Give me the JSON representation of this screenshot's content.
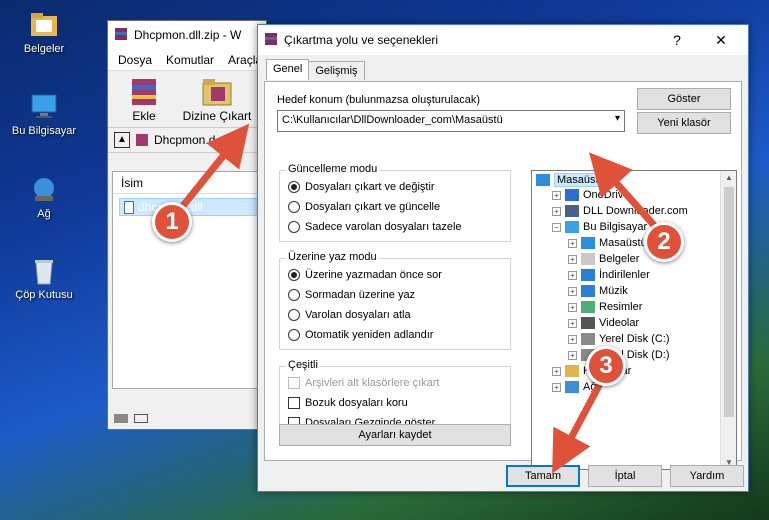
{
  "desktop": {
    "icons": [
      {
        "label": "Belgeler",
        "icon": "folder-icon"
      },
      {
        "label": "Bu Bilgisayar",
        "icon": "computer-icon"
      },
      {
        "label": "Ağ",
        "icon": "network-icon"
      },
      {
        "label": "Çöp Kutusu",
        "icon": "recycle-bin-icon"
      }
    ]
  },
  "winrar": {
    "title": "Dhcpmon.dll.zip - W",
    "menu": [
      "Dosya",
      "Komutlar",
      "Araçla"
    ],
    "tools": {
      "add": "Ekle",
      "extract": "Dizine Çıkart"
    },
    "address": "Dhcpmon.d",
    "column_name": "İsim",
    "file": "dhcpmon.dll"
  },
  "dialog": {
    "title": "Çıkartma yolu ve seçenekleri",
    "help": "?",
    "close": "✕",
    "tabs": [
      "Genel",
      "Gelişmiş"
    ],
    "dest_label": "Hedef konum (bulunmazsa oluşturulacak)",
    "dest_value": "C:\\Kullanıcılar\\DllDownloader_com\\Masaüstü",
    "show_btn": "Göster",
    "new_folder_btn": "Yeni klasör",
    "update_group": {
      "title": "Güncelleme modu",
      "options": [
        "Dosyaları çıkart ve değiştir",
        "Dosyaları çıkart ve güncelle",
        "Sadece varolan dosyaları tazele"
      ],
      "selected": 0
    },
    "overwrite_group": {
      "title": "Üzerine yaz modu",
      "options": [
        "Üzerine yazmadan önce sor",
        "Sormadan üzerine yaz",
        "Varolan dosyaları atla",
        "Otomatik yeniden adlandır"
      ],
      "selected": 0
    },
    "misc_group": {
      "title": "Çeşitli",
      "options": [
        "Arşivleri alt klasörlere çıkart",
        "Bozuk dosyaları koru",
        "Dosyaları Gezginde göster"
      ]
    },
    "save_settings_btn": "Ayarları kaydet",
    "tree": [
      {
        "label": "Masaüstü",
        "level": 0,
        "icon": "desktop-icon",
        "selected": true
      },
      {
        "label": "OneDrive",
        "level": 1,
        "icon": "cloud-icon"
      },
      {
        "label": "DLL Downloader.com",
        "level": 1,
        "icon": "user-icon"
      },
      {
        "label": "Bu Bilgisayar",
        "level": 1,
        "icon": "computer-icon",
        "expanded": true
      },
      {
        "label": "Masaüstü",
        "level": 2,
        "icon": "desktop-icon"
      },
      {
        "label": "Belgeler",
        "level": 2,
        "icon": "documents-icon"
      },
      {
        "label": "İndirilenler",
        "level": 2,
        "icon": "download-icon"
      },
      {
        "label": "Müzik",
        "level": 2,
        "icon": "music-icon"
      },
      {
        "label": "Resimler",
        "level": 2,
        "icon": "pictures-icon"
      },
      {
        "label": "Videolar",
        "level": 2,
        "icon": "videos-icon"
      },
      {
        "label": "Yerel Disk (C:)",
        "level": 2,
        "icon": "drive-icon"
      },
      {
        "label": "Yerel Disk (D:)",
        "level": 2,
        "icon": "drive-icon"
      },
      {
        "label": "Kitaplıklar",
        "level": 1,
        "icon": "libraries-icon"
      },
      {
        "label": "Ağ",
        "level": 1,
        "icon": "network-icon"
      }
    ],
    "ok_btn": "Tamam",
    "cancel_btn": "İptal",
    "help_btn": "Yardım"
  },
  "annotations": {
    "step1": "1",
    "step2": "2",
    "step3": "3"
  },
  "colors": {
    "arrow": "#e0513a",
    "selection": "#cce8ff",
    "accent": "#0078d7"
  }
}
